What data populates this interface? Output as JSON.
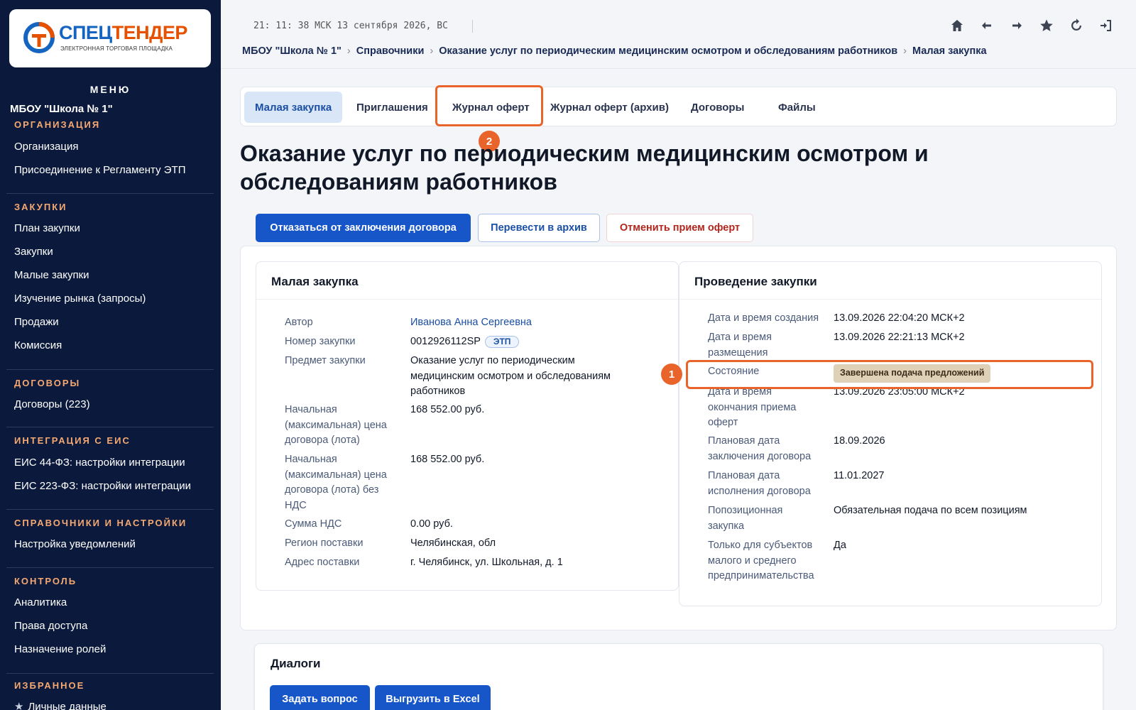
{
  "brand": {
    "name_part1": "СПЕЦ",
    "name_part2": "ТЕНДЕР",
    "subtitle": "ЭЛЕКТРОННАЯ ТОРГОВАЯ ПЛОЩАДКА",
    "primary_color": "#1565c0",
    "accent_color": "#e65100"
  },
  "sidebar": {
    "menu_title": "МЕНЮ",
    "org_name": "МБОУ \"Школа № 1\"",
    "sections": [
      {
        "title": "ОРГАНИЗАЦИЯ",
        "items": [
          "Организация",
          "Присоединение к Регламенту ЭТП"
        ]
      },
      {
        "title": "ЗАКУПКИ",
        "items": [
          "План закупки",
          "Закупки",
          "Малые закупки",
          "Изучение рынка (запросы)",
          "Продажи",
          "Комиссия"
        ]
      },
      {
        "title": "ДОГОВОРЫ",
        "items": [
          "Договоры (223)"
        ]
      },
      {
        "title": "ИНТЕГРАЦИЯ С ЕИС",
        "items": [
          "ЕИС 44-ФЗ: настройки интеграции",
          "ЕИС 223-ФЗ: настройки интеграции"
        ]
      },
      {
        "title": "СПРАВОЧНИКИ И НАСТРОЙКИ",
        "items": [
          "Настройка уведомлений"
        ]
      },
      {
        "title": "КОНТРОЛЬ",
        "items": [
          "Аналитика",
          "Права доступа",
          "Назначение ролей"
        ]
      },
      {
        "title": "ИЗБРАННОЕ",
        "items": [
          "Личные данные"
        ]
      }
    ]
  },
  "header": {
    "clock": "21: 11: 38 МСК  13 сентября 2026, ВС",
    "icons": [
      "home-icon",
      "back-arrow-icon",
      "forward-arrow-icon",
      "star-icon",
      "refresh-icon",
      "logout-icon"
    ],
    "breadcrumb": [
      "МБОУ \"Школа № 1\"",
      "Справочники",
      "Оказание услуг по периодическим медицинским осмотром и обследованиям работников",
      "Малая закупка"
    ]
  },
  "tabs": [
    "Малая закупка",
    "Приглашения",
    "Журнал оферт",
    "Журнал оферт (архив)",
    "Договоры",
    "Файлы"
  ],
  "active_tab": "Малая закупка",
  "title": "Оказание услуг по периодическим медицинским осмотром и обследованиям работников",
  "actions": {
    "decline": "Отказаться от заключения договора",
    "archive": "Перевести в архив",
    "cancel": "Отменить прием оферт"
  },
  "purchase_panel": {
    "title": "Малая закупка",
    "rows": [
      {
        "label": "Автор",
        "value": "Иванова Анна Сергеевна"
      },
      {
        "label": "Номер закупки",
        "value": "0012926112SP",
        "badge": "ЭТП"
      },
      {
        "label": "Предмет закупки",
        "value": "Оказание услуг по периодическим медицинским осмотром и обследованиям работников"
      },
      {
        "label": "Начальная (максимальная) цена договора (лота)",
        "value": "168 552.00 руб."
      },
      {
        "label": "Начальная (максимальная) цена договора (лота) без НДС",
        "value": "168 552.00 руб."
      },
      {
        "label": "Сумма НДС",
        "value": "0.00 руб."
      },
      {
        "label": "Регион поставки",
        "value": "Челябинская, обл"
      },
      {
        "label": "Адрес поставки",
        "value": "г. Челябинск, ул. Школьная, д. 1"
      }
    ]
  },
  "conduct_panel": {
    "title": "Проведение закупки",
    "rows": [
      {
        "label": "Дата и время создания",
        "value": "13.09.2026 22:04:20 МСК+2"
      },
      {
        "label": "Дата и время размещения",
        "value": "13.09.2026 22:21:13 МСК+2"
      },
      {
        "label": "Состояние",
        "value": "Завершена подача предложений"
      },
      {
        "label": "Дата и время окончания приема оферт",
        "value": "13.09.2026 23:05:00 МСК+2"
      },
      {
        "label": "Плановая дата заключения договора",
        "value": "18.09.2026"
      },
      {
        "label": "Плановая дата исполнения договора",
        "value": "11.01.2027"
      },
      {
        "label": "Попозиционная закупка",
        "value": "Обязательная подача по всем позициям"
      },
      {
        "label": "Только для субъектов малого и среднего предпринимательства",
        "value": "Да"
      }
    ]
  },
  "annotations": {
    "marker1": "1",
    "marker2": "2",
    "color": "#e8642a"
  },
  "dialogs": {
    "title": "Диалоги",
    "ask_button": "Задать вопрос",
    "export_button": "Выгрузить в Excel"
  }
}
